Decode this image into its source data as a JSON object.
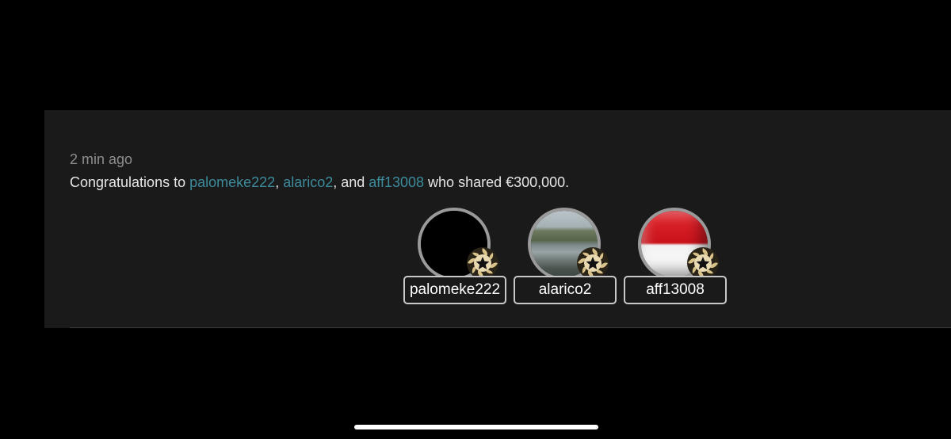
{
  "feed_item": {
    "timestamp": "2 min ago",
    "message": {
      "prefix": "Congratulations to ",
      "winner_1": "palomeke222",
      "sep_1": ", ",
      "winner_2": "alarico2",
      "sep_2": ", and ",
      "winner_3": "aff13008",
      "suffix": " who shared €300,000."
    },
    "winners": [
      {
        "name": "palomeke222",
        "avatar": "black-avatar"
      },
      {
        "name": "alarico2",
        "avatar": "landscape-photo-avatar"
      },
      {
        "name": "aff13008",
        "avatar": "indonesia-flag-avatar"
      }
    ],
    "badge_icon": "star-medal-icon"
  },
  "colors": {
    "background": "#000000",
    "card": "#1a1a1a",
    "link": "#3c8c9c",
    "text": "#e6e6e6",
    "muted": "#8e8e8e"
  }
}
